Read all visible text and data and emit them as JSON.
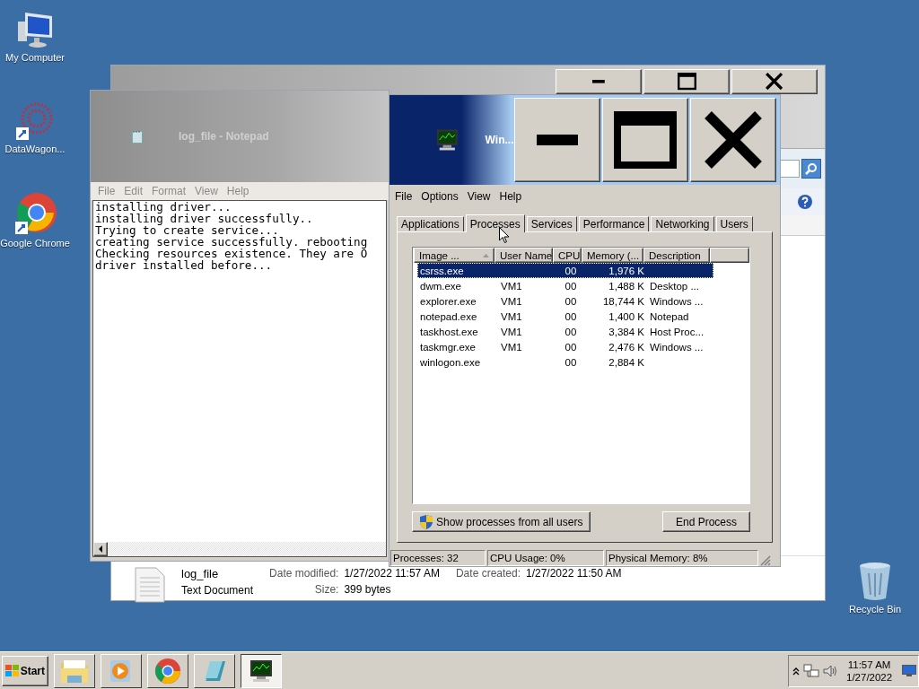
{
  "desktop_icons": [
    {
      "label": "My Computer",
      "kind": "computer"
    },
    {
      "label": "DataWagon...",
      "kind": "datawagon"
    },
    {
      "label": "Google Chrome",
      "kind": "chrome"
    },
    {
      "label": "Recycle Bin",
      "kind": "recycle"
    }
  ],
  "explorer_window": {
    "details": {
      "name": "log_file",
      "type": "Text Document",
      "fields": [
        {
          "label": "Date modified:",
          "value": "1/27/2022 11:57 AM"
        },
        {
          "label": "Size:",
          "value": "399 bytes"
        },
        {
          "label": "Date created:",
          "value": "1/27/2022 11:50 AM"
        }
      ]
    }
  },
  "notepad": {
    "title": "log_file - Notepad",
    "menu": [
      "File",
      "Edit",
      "Format",
      "View",
      "Help"
    ],
    "lines": [
      "installing driver...",
      "installing driver successfully..",
      "Trying to create service...",
      "creating service successfully. rebooting",
      "Checking resources existence. They are O",
      "driver installed before..."
    ]
  },
  "task_manager": {
    "title": "Win...",
    "menu": [
      "File",
      "Options",
      "View",
      "Help"
    ],
    "tabs": [
      {
        "label": "Applications",
        "selected": false
      },
      {
        "label": "Processes",
        "selected": true
      },
      {
        "label": "Services",
        "selected": false
      },
      {
        "label": "Performance",
        "selected": false
      },
      {
        "label": "Networking",
        "selected": false
      },
      {
        "label": "Users",
        "selected": false
      }
    ],
    "columns": [
      "Image ...",
      "User Name",
      "CPU",
      "Memory (...",
      "Description"
    ],
    "rows": [
      {
        "cells": [
          "csrss.exe",
          "",
          "00",
          "1,976 K",
          ""
        ],
        "selected": true
      },
      {
        "cells": [
          "dwm.exe",
          "VM1",
          "00",
          "1,488 K",
          "Desktop ..."
        ],
        "selected": false
      },
      {
        "cells": [
          "explorer.exe",
          "VM1",
          "00",
          "18,744 K",
          "Windows ..."
        ],
        "selected": false
      },
      {
        "cells": [
          "notepad.exe",
          "VM1",
          "00",
          "1,400 K",
          "Notepad"
        ],
        "selected": false
      },
      {
        "cells": [
          "taskhost.exe",
          "VM1",
          "00",
          "3,384 K",
          "Host Proc..."
        ],
        "selected": false
      },
      {
        "cells": [
          "taskmgr.exe",
          "VM1",
          "00",
          "2,476 K",
          "Windows ..."
        ],
        "selected": false
      },
      {
        "cells": [
          "winlogon.exe",
          "",
          "00",
          "2,884 K",
          ""
        ],
        "selected": false
      }
    ],
    "show_all_button": "Show processes from all users",
    "end_button": "End Process",
    "status": [
      "Processes: 32",
      "CPU Usage: 0%",
      "Physical Memory: 8%"
    ]
  },
  "taskbar": {
    "start": "Start",
    "apps": [
      {
        "kind": "explorer",
        "selected": false
      },
      {
        "kind": "media",
        "selected": false
      },
      {
        "kind": "chrome",
        "selected": false
      },
      {
        "kind": "notepad",
        "selected": false
      },
      {
        "kind": "taskmgr",
        "selected": true
      }
    ],
    "clock": {
      "time": "11:57 AM",
      "date": "1/27/2022"
    }
  }
}
